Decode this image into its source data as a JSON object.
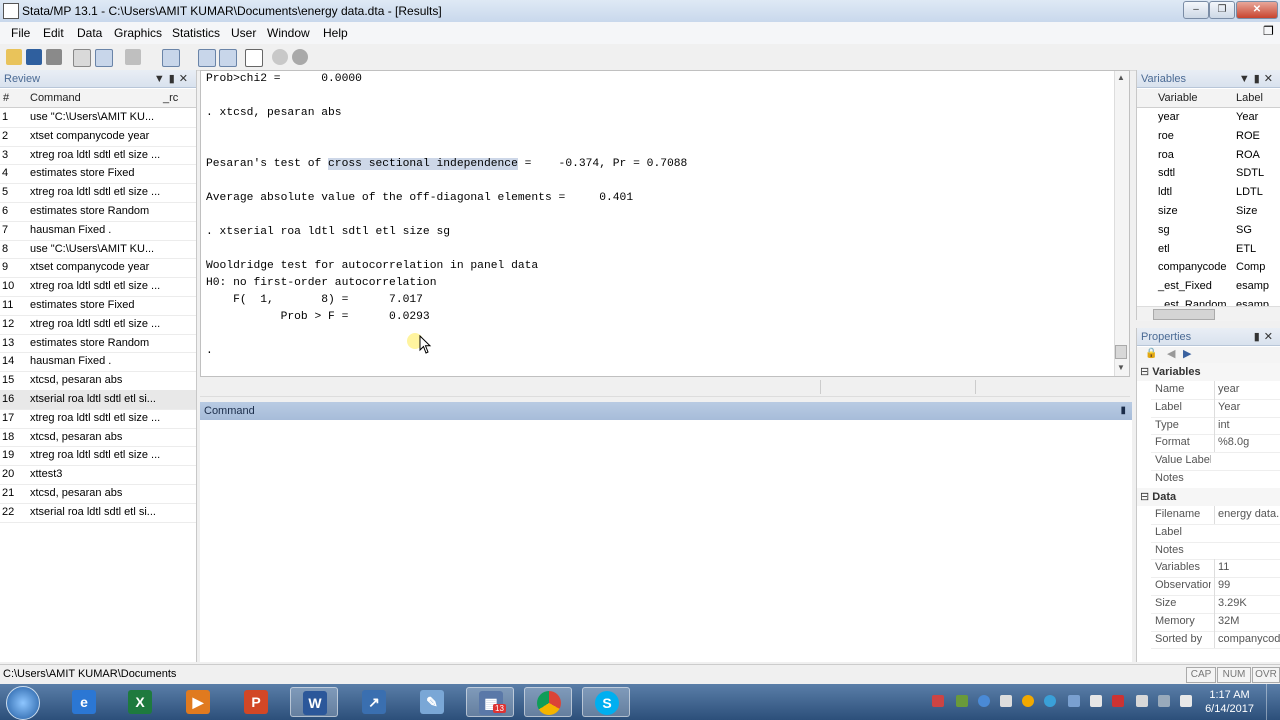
{
  "window": {
    "title": "Stata/MP 13.1 - C:\\Users\\AMIT KUMAR\\Documents\\energy data.dta - [Results]"
  },
  "menu": [
    "File",
    "Edit",
    "Data",
    "Graphics",
    "Statistics",
    "User",
    "Window",
    "Help"
  ],
  "review": {
    "title": "Review",
    "col_num": "#",
    "col_cmd": "Command",
    "col_rc": "_rc",
    "items": [
      {
        "n": "1",
        "cmd": "use \"C:\\Users\\AMIT KU..."
      },
      {
        "n": "2",
        "cmd": "xtset companycode year"
      },
      {
        "n": "3",
        "cmd": "xtreg roa ldtl sdtl etl size ..."
      },
      {
        "n": "4",
        "cmd": "estimates store Fixed"
      },
      {
        "n": "5",
        "cmd": "xtreg roa ldtl sdtl etl size ..."
      },
      {
        "n": "6",
        "cmd": "estimates store Random"
      },
      {
        "n": "7",
        "cmd": "hausman Fixed ."
      },
      {
        "n": "8",
        "cmd": "use \"C:\\Users\\AMIT KU..."
      },
      {
        "n": "9",
        "cmd": "xtset companycode year"
      },
      {
        "n": "10",
        "cmd": "xtreg roa ldtl sdtl etl size ..."
      },
      {
        "n": "11",
        "cmd": "estimates store Fixed"
      },
      {
        "n": "12",
        "cmd": "xtreg roa ldtl sdtl etl size ..."
      },
      {
        "n": "13",
        "cmd": "estimates store Random"
      },
      {
        "n": "14",
        "cmd": "hausman Fixed ."
      },
      {
        "n": "15",
        "cmd": "xtcsd, pesaran abs"
      },
      {
        "n": "16",
        "cmd": "xtserial roa ldtl sdtl etl si..."
      },
      {
        "n": "17",
        "cmd": "xtreg roa ldtl sdtl etl size ..."
      },
      {
        "n": "18",
        "cmd": "xtcsd, pesaran abs"
      },
      {
        "n": "19",
        "cmd": "xtreg roa ldtl sdtl etl size ..."
      },
      {
        "n": "20",
        "cmd": "xttest3"
      },
      {
        "n": "21",
        "cmd": "xtcsd, pesaran abs"
      },
      {
        "n": "22",
        "cmd": "xtserial roa ldtl sdtl etl si..."
      }
    ]
  },
  "results": {
    "l1": "Prob>chi2 =      0.0000",
    "l2": ". xtcsd, pesaran abs",
    "l3a": "Pesaran's test of ",
    "l3hl": "cross sectional independence",
    "l3b": " =    -0.374, Pr = 0.7088",
    "l4": "Average absolute value of the off-diagonal elements =     0.401",
    "l5": ". xtserial roa ldtl sdtl etl size sg",
    "l6": "Wooldridge test for autocorrelation in panel data",
    "l7": "H0: no first-order autocorrelation",
    "l8": "    F(  1,       8) =      7.017",
    "l9": "           Prob > F =      0.0293",
    "l10": "."
  },
  "command": {
    "title": "Command"
  },
  "variables": {
    "title": "Variables",
    "col_name": "Variable",
    "col_label": "Label",
    "items": [
      {
        "name": "year",
        "label": "Year"
      },
      {
        "name": "roe",
        "label": "ROE"
      },
      {
        "name": "roa",
        "label": "ROA"
      },
      {
        "name": "sdtl",
        "label": "SDTL"
      },
      {
        "name": "ldtl",
        "label": "LDTL"
      },
      {
        "name": "size",
        "label": "Size"
      },
      {
        "name": "sg",
        "label": "SG"
      },
      {
        "name": "etl",
        "label": "ETL"
      },
      {
        "name": "companycode",
        "label": "Comp"
      },
      {
        "name": "_est_Fixed",
        "label": "esamp"
      },
      {
        "name": "_est_Random",
        "label": "esamp"
      }
    ]
  },
  "properties": {
    "title": "Properties",
    "sec_vars": "Variables",
    "vars": [
      {
        "k": "Name",
        "v": "year"
      },
      {
        "k": "Label",
        "v": "Year"
      },
      {
        "k": "Type",
        "v": "int"
      },
      {
        "k": "Format",
        "v": "%8.0g"
      },
      {
        "k": "Value Label",
        "v": ""
      },
      {
        "k": "Notes",
        "v": ""
      }
    ],
    "sec_data": "Data",
    "data": [
      {
        "k": "Filename",
        "v": "energy data..."
      },
      {
        "k": "Label",
        "v": ""
      },
      {
        "k": "Notes",
        "v": ""
      },
      {
        "k": "Variables",
        "v": "11"
      },
      {
        "k": "Observations",
        "v": "99"
      },
      {
        "k": "Size",
        "v": "3.29K"
      },
      {
        "k": "Memory",
        "v": "32M"
      },
      {
        "k": "Sorted by",
        "v": "companycode"
      }
    ]
  },
  "status": {
    "path": "C:\\Users\\AMIT KUMAR\\Documents",
    "cap": "CAP",
    "num": "NUM",
    "ovr": "OVR"
  },
  "taskbar": {
    "time": "1:17 AM",
    "date": "6/14/2017",
    "badge": "13"
  },
  "colors": {
    "accent": "#4a6a94",
    "highlight": "#cdd7e8",
    "cmdbar": "#a7bcd9"
  }
}
